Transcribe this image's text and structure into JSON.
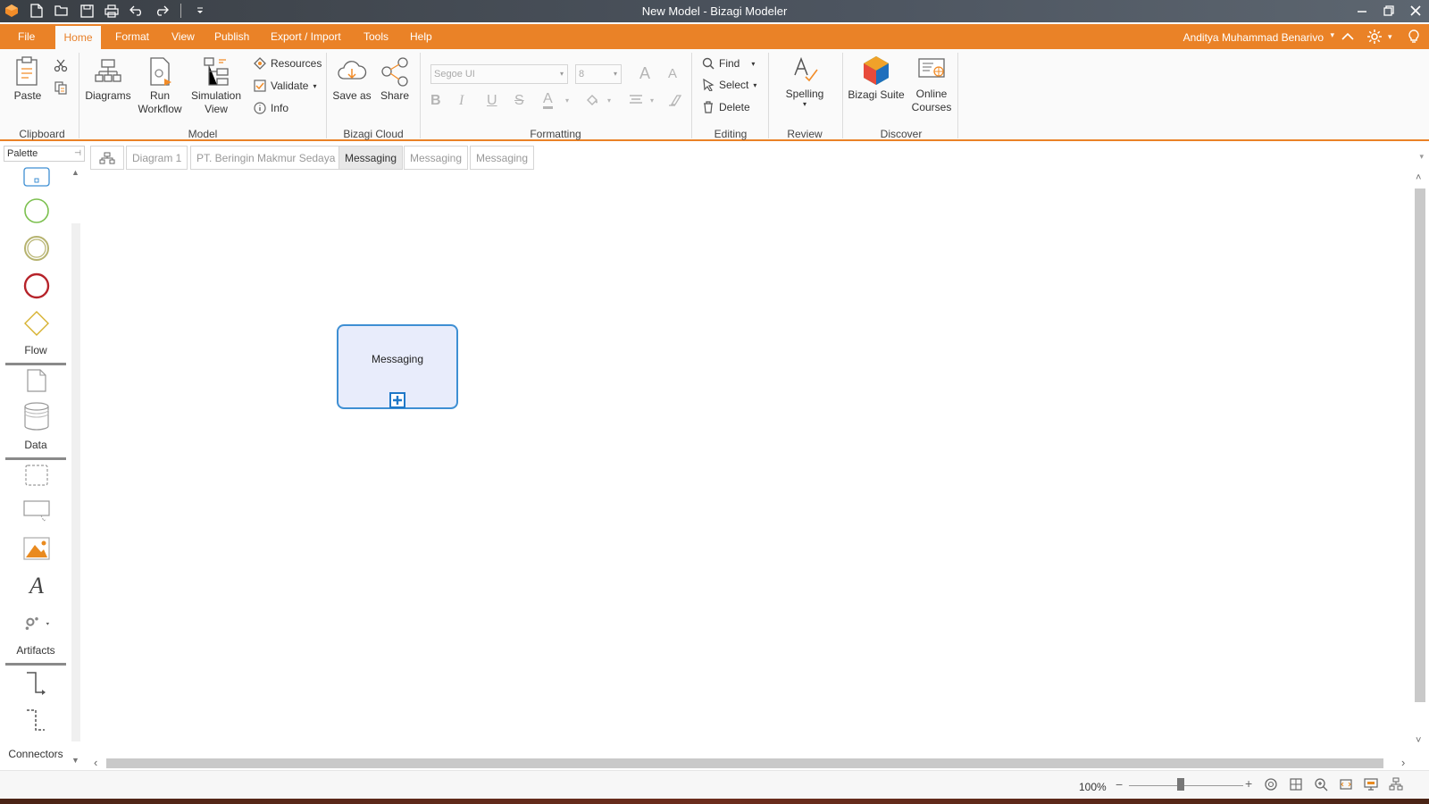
{
  "window": {
    "title": "New Model - Bizagi Modeler",
    "quick_access": [
      "app-logo",
      "new-icon",
      "open-icon",
      "save-icon",
      "print-icon",
      "undo-icon",
      "redo-icon",
      "customize-icon"
    ]
  },
  "menu": {
    "file": "File",
    "tabs": [
      "Home",
      "Format",
      "View",
      "Publish",
      "Export / Import",
      "Tools",
      "Help"
    ],
    "active_tab": "Home",
    "user": "Anditya Muhammad Benarivo",
    "accent_color": "#ea8227"
  },
  "ribbon": {
    "clipboard": {
      "label": "Clipboard",
      "paste": "Paste"
    },
    "model": {
      "label": "Model",
      "diagrams": "Diagrams",
      "run_workflow": "Run Workflow",
      "simulation_view": "Simulation View",
      "resources": "Resources",
      "validate": "Validate",
      "info": "Info"
    },
    "cloud": {
      "label": "Bizagi Cloud",
      "save_as": "Save as",
      "share": "Share"
    },
    "formatting": {
      "label": "Formatting",
      "font": "Segoe UI",
      "size": "8"
    },
    "editing": {
      "label": "Editing",
      "find": "Find",
      "select": "Select",
      "delete": "Delete"
    },
    "review": {
      "label": "Review",
      "spelling": "Spelling"
    },
    "discover": {
      "label": "Discover",
      "bizagi_suite": "Bizagi Suite",
      "online_courses": "Online Courses"
    }
  },
  "palette": {
    "title": "Palette",
    "sections": {
      "flow": "Flow",
      "data": "Data",
      "artifacts": "Artifacts",
      "connectors": "Connectors"
    }
  },
  "tabs": [
    {
      "label": "Diagram 1",
      "active": false
    },
    {
      "label": "PT. Beringin Makmur Sedaya",
      "active": false
    },
    {
      "label": "Messaging",
      "active": true
    },
    {
      "label": "Messaging",
      "active": false
    },
    {
      "label": "Messaging",
      "active": false
    }
  ],
  "canvas": {
    "shapes": [
      {
        "type": "subprocess",
        "label": "Messaging"
      }
    ]
  },
  "status": {
    "zoom": "100%",
    "zoom_level": 0.45
  }
}
